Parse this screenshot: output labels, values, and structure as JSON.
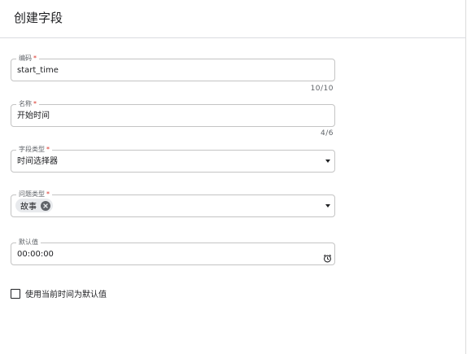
{
  "header": {
    "title": "创建字段"
  },
  "form": {
    "code": {
      "label": "编码",
      "required": "*",
      "value": "start_time",
      "counter": "10/10"
    },
    "name": {
      "label": "名称",
      "required": "*",
      "value": "开始时间",
      "counter": "4/6"
    },
    "field_type": {
      "label": "字段类型",
      "required": "*",
      "value": "时间选择器"
    },
    "issue_type": {
      "label": "问题类型",
      "required": "*",
      "chips": [
        "故事"
      ]
    },
    "default_value": {
      "label": "默认值",
      "value": "00:00:00"
    },
    "use_current_time": {
      "label": "使用当前时间为默认值",
      "checked": false
    }
  },
  "icons": {
    "dropdown": "caret-down-icon",
    "chip_remove": "close-circle-icon",
    "time_picker": "clock-icon",
    "checkbox": "checkbox-unchecked-icon"
  },
  "colors": {
    "required": "#d93025",
    "border": "#c4c4c4",
    "chip_bg": "#e8eaed"
  }
}
